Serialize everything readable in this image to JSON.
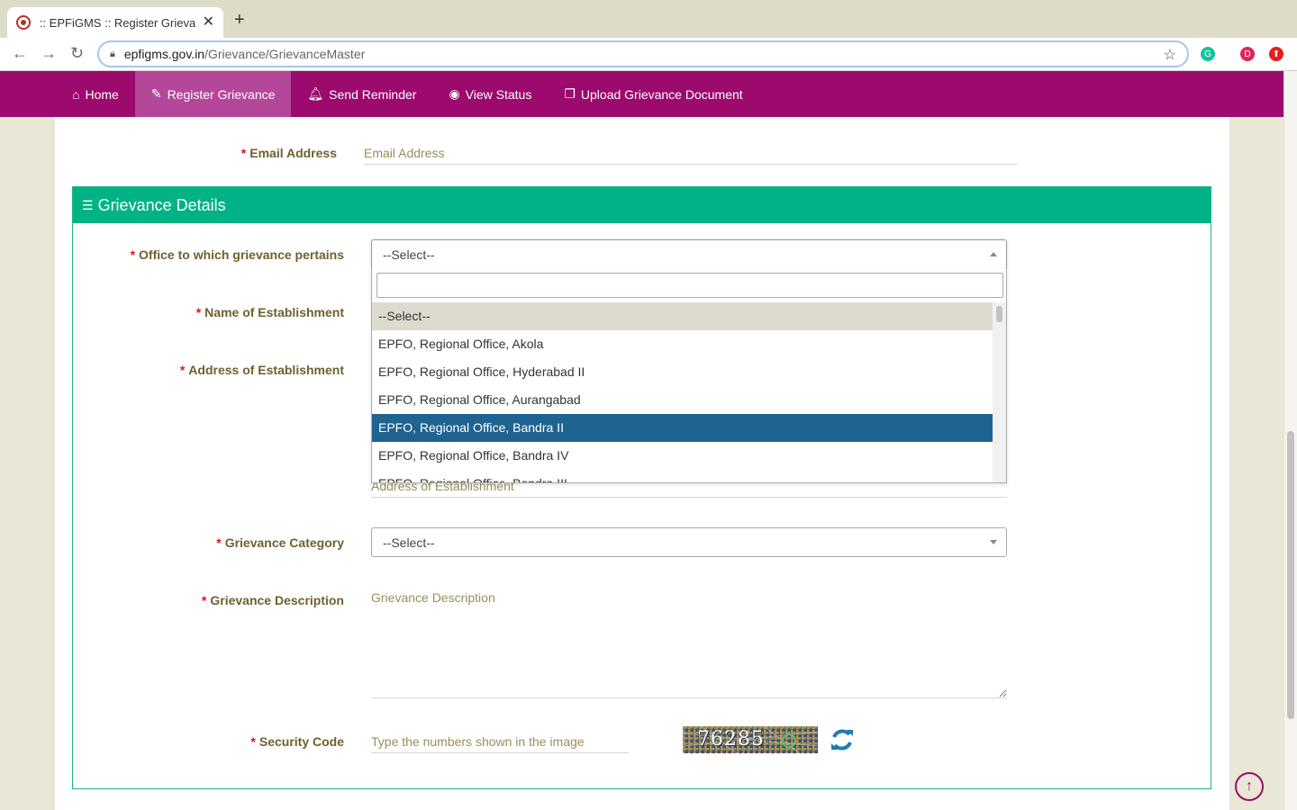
{
  "browser": {
    "tab_title": ":: EPFiGMS :: Register Grievance",
    "url_host": "epfigms.gov.in",
    "url_path": "/Grievance/GrievanceMaster",
    "ext_d_label": "D"
  },
  "nav": {
    "items": [
      {
        "label": "Home",
        "icon": "home-icon"
      },
      {
        "label": "Register Grievance",
        "icon": "edit-icon"
      },
      {
        "label": "Send Reminder",
        "icon": "bell-icon"
      },
      {
        "label": "View Status",
        "icon": "eye-icon"
      },
      {
        "label": "Upload Grievance Document",
        "icon": "document-icon"
      }
    ],
    "active": "Register Grievance",
    "color": "#9b0a6c"
  },
  "form": {
    "email_label": "Email Address",
    "email_placeholder": "Email Address",
    "section_title": "Grievance Details",
    "office_label": "Office to which grievance pertains",
    "office_value": "--Select--",
    "establishment_name_label": "Name of Establishment",
    "establishment_address_label": "Address of Establishment",
    "establishment_address_placeholder": "Address of Establishment",
    "category_label": "Grievance Category",
    "category_value": "--Select--",
    "description_label": "Grievance Description",
    "description_placeholder": "Grievance Description",
    "security_label": "Security Code",
    "security_placeholder": "Type the numbers shown in the image",
    "captcha_text": "76285"
  },
  "dropdown": {
    "search_value": "",
    "options": [
      "--Select--",
      "EPFO, Regional Office, Akola",
      "EPFO, Regional Office, Hyderabad II",
      "EPFO, Regional Office, Aurangabad",
      "EPFO, Regional Office, Bandra II",
      "EPFO, Regional Office, Bandra IV",
      "EPFO, Regional Office, Bandra III"
    ],
    "selected_index": 0,
    "highlighted_index": 4
  },
  "colors": {
    "section_header": "#00b386",
    "highlight": "#1f6390",
    "label": "#6f6030",
    "required": "#d9171b"
  }
}
